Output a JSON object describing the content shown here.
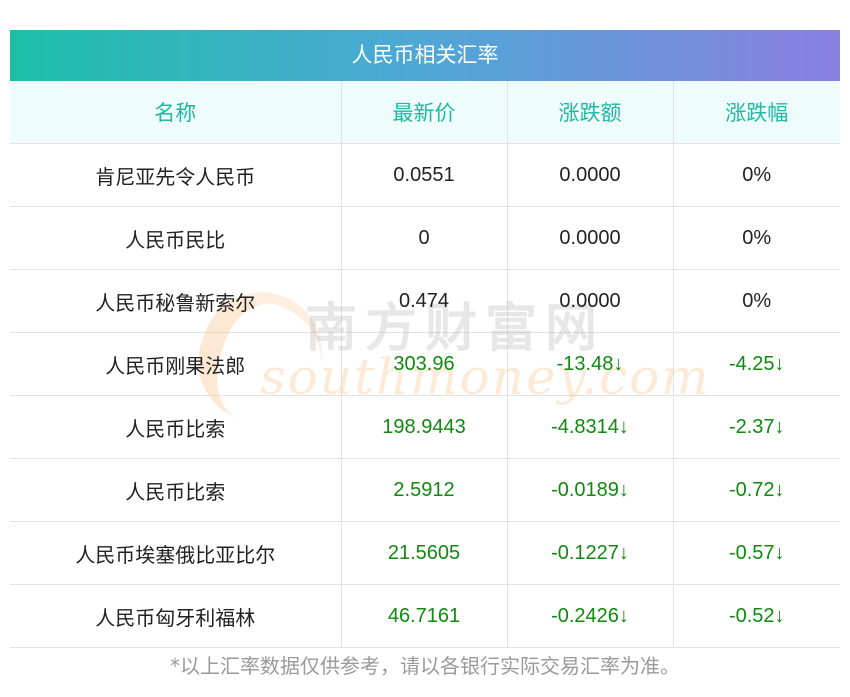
{
  "title": "人民币相关汇率",
  "columns": [
    "名称",
    "最新价",
    "涨跌额",
    "涨跌幅"
  ],
  "rows": [
    {
      "name": "肯尼亚先令人民币",
      "price": "0.0551",
      "change": "0.0000",
      "pct": "0%",
      "down": false
    },
    {
      "name": "人民币民比",
      "price": "0",
      "change": "0.0000",
      "pct": "0%",
      "down": false
    },
    {
      "name": "人民币秘鲁新索尔",
      "price": "0.474",
      "change": "0.0000",
      "pct": "0%",
      "down": false
    },
    {
      "name": "人民币刚果法郎",
      "price": "303.96",
      "change": "-13.48↓",
      "pct": "-4.25↓",
      "down": true
    },
    {
      "name": "人民币比索",
      "price": "198.9443",
      "change": "-4.8314↓",
      "pct": "-2.37↓",
      "down": true
    },
    {
      "name": "人民币比索",
      "price": "2.5912",
      "change": "-0.0189↓",
      "pct": "-0.72↓",
      "down": true
    },
    {
      "name": "人民币埃塞俄比亚比尔",
      "price": "21.5605",
      "change": "-0.1227↓",
      "pct": "-0.57↓",
      "down": true
    },
    {
      "name": "人民币匈牙利福林",
      "price": "46.7161",
      "change": "-0.2426↓",
      "pct": "-0.52↓",
      "down": true
    }
  ],
  "footnote": "*以上汇率数据仅供参考，请以各银行实际交易汇率为准。",
  "watermark": {
    "cn": "南方财富网",
    "en": "southmoney.com"
  },
  "colors": {
    "header_gradient_start": "#1dbfa8",
    "header_gradient_end": "#8a7fe0",
    "column_header_text": "#22b8a4",
    "column_header_bg": "#eefcfb",
    "down_text": "#0f8a0f",
    "footnote_text": "#9a9a9a"
  }
}
